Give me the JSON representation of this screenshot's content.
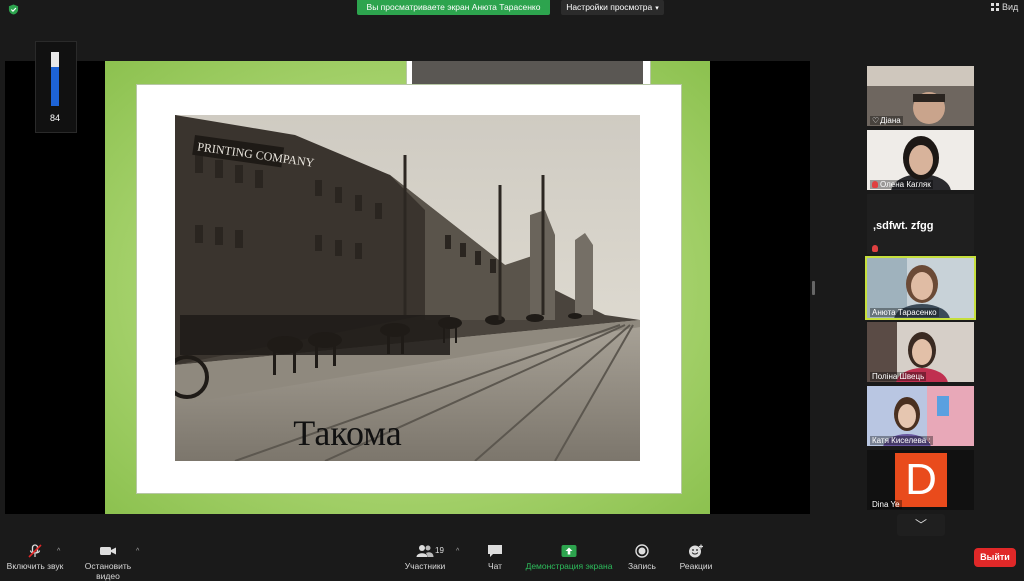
{
  "top": {
    "share_banner": "Вы просматриваете экран Анюта Тарасенко",
    "view_settings": "Настройки просмотра",
    "view_button": "Вид"
  },
  "audio_meter": {
    "value": "84",
    "level_percent": 72
  },
  "slide": {
    "caption": "Такома"
  },
  "participants": [
    {
      "name": "Діана",
      "type": "video",
      "active": false,
      "heart": true
    },
    {
      "name": "Олена Кагляк",
      "type": "video",
      "active": false,
      "muted": true
    },
    {
      "name": "",
      "type": "text",
      "display_text": ",sdfwt. zfgg",
      "muted": true
    },
    {
      "name": "Анюта Тарасенко",
      "type": "video",
      "active": true
    },
    {
      "name": "Поліна Швець",
      "type": "video",
      "active": false
    },
    {
      "name": "Катя Киселева :",
      "type": "video",
      "active": false
    },
    {
      "name": "Dina Ye",
      "type": "avatar",
      "initial": "D"
    }
  ],
  "toolbar": {
    "unmute": "Включить звук",
    "start_video": "Остановить видео",
    "participants": "Участники",
    "participants_count": "19",
    "chat": "Чат",
    "share_screen": "Демонстрация экрана",
    "record": "Запись",
    "reactions": "Реакции",
    "leave": "Выйти"
  },
  "colors": {
    "share_green": "#2da44e",
    "leave_red": "#e02828",
    "active_outline": "#c6df3c",
    "meter_blue": "#1d63d6"
  }
}
